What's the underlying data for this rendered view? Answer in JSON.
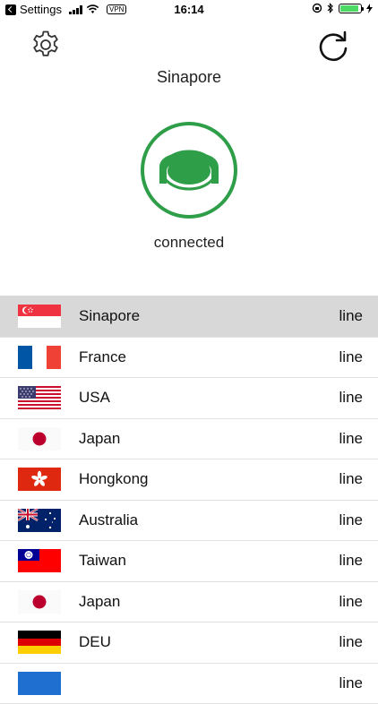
{
  "status_bar": {
    "back_app": "Settings",
    "vpn_badge": "VPN",
    "time": "16:14",
    "battery_level": 0.9
  },
  "header": {
    "settings_icon": "gear-icon",
    "refresh_icon": "refresh-icon"
  },
  "connection": {
    "location": "Sinapore",
    "status": "connected",
    "icon": "connect-power-icon",
    "accent_color": "#2e9e48"
  },
  "servers": [
    {
      "name": "Sinapore",
      "status": "line",
      "flag": "singapore",
      "selected": true
    },
    {
      "name": "France",
      "status": "line",
      "flag": "france"
    },
    {
      "name": "USA",
      "status": "line",
      "flag": "usa"
    },
    {
      "name": "Japan",
      "status": "line",
      "flag": "japan"
    },
    {
      "name": "Hongkong",
      "status": "line",
      "flag": "hongkong"
    },
    {
      "name": "Australia",
      "status": "line",
      "flag": "australia"
    },
    {
      "name": "Taiwan",
      "status": "line",
      "flag": "taiwan"
    },
    {
      "name": "Japan",
      "status": "line",
      "flag": "japan"
    },
    {
      "name": "DEU",
      "status": "line",
      "flag": "germany"
    },
    {
      "name": "",
      "status": "line",
      "flag": "partial-blue"
    }
  ]
}
